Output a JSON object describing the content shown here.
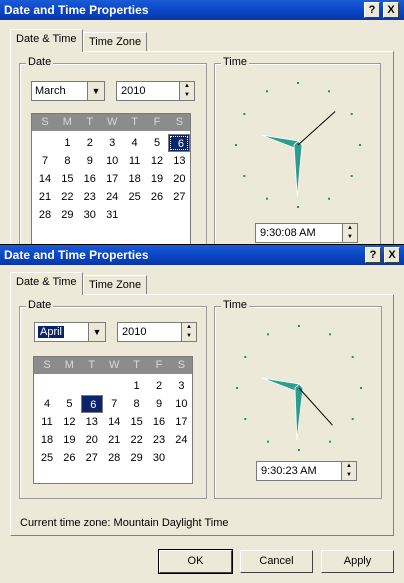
{
  "dialog_back": {
    "title": "Date and Time Properties",
    "help_label": "?",
    "close_label": "X",
    "tabs": [
      "Date & Time",
      "Time Zone"
    ],
    "date_group_label": "Date",
    "time_group_label": "Time",
    "month_value": "March",
    "year_value": "2010",
    "weekday_headers": [
      "S",
      "M",
      "T",
      "W",
      "T",
      "F",
      "S"
    ],
    "days": [
      [
        "",
        "1",
        "2",
        "3",
        "4",
        "5",
        "6"
      ],
      [
        "7",
        "8",
        "9",
        "10",
        "11",
        "12",
        "13"
      ],
      [
        "14",
        "15",
        "16",
        "17",
        "18",
        "19",
        "20"
      ],
      [
        "21",
        "22",
        "23",
        "24",
        "25",
        "26",
        "27"
      ],
      [
        "28",
        "29",
        "30",
        "31",
        "",
        "",
        ""
      ]
    ],
    "selected_day": "6",
    "time_value": "9:30:08 AM"
  },
  "dialog_front": {
    "title": "Date and Time Properties",
    "help_label": "?",
    "close_label": "X",
    "tabs": [
      "Date & Time",
      "Time Zone"
    ],
    "date_group_label": "Date",
    "time_group_label": "Time",
    "month_value": "April",
    "year_value": "2010",
    "weekday_headers": [
      "S",
      "M",
      "T",
      "W",
      "T",
      "F",
      "S"
    ],
    "days": [
      [
        "",
        "",
        "",
        "",
        "1",
        "2",
        "3"
      ],
      [
        "4",
        "5",
        "6",
        "7",
        "8",
        "9",
        "10"
      ],
      [
        "11",
        "12",
        "13",
        "14",
        "15",
        "16",
        "17"
      ],
      [
        "18",
        "19",
        "20",
        "21",
        "22",
        "23",
        "24"
      ],
      [
        "25",
        "26",
        "27",
        "28",
        "29",
        "30",
        ""
      ]
    ],
    "selected_day": "6",
    "time_value": "9:30:23 AM",
    "timezone_label": "Current time zone:",
    "timezone_value": "Mountain Daylight Time",
    "ok_label": "OK",
    "cancel_label": "Cancel",
    "apply_label": "Apply"
  },
  "colors": {
    "titlebar": "#0a44c4",
    "selection": "#0a246a",
    "clock_hand": "#2a9d8f",
    "clock_dot": "#1f8f7a"
  }
}
